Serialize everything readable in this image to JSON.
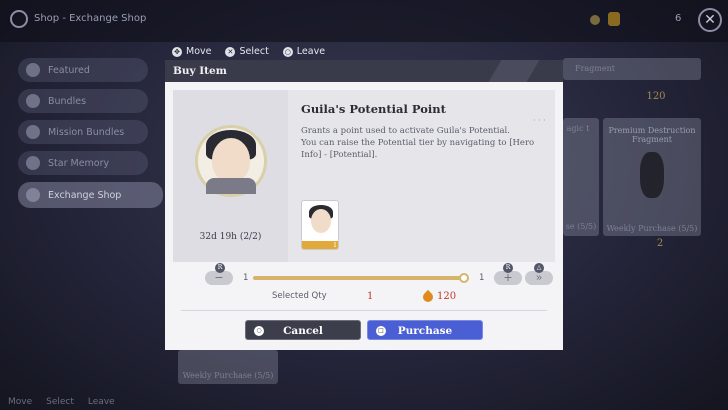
{
  "header": {
    "breadcrumb": "Shop - Exchange Shop",
    "top_count": "6",
    "close_symbol": "✕"
  },
  "hints": [
    {
      "icon": "✥",
      "label": "Move"
    },
    {
      "icon": "✕",
      "label": "Select"
    },
    {
      "icon": "○",
      "label": "Leave"
    }
  ],
  "sidebar": {
    "items": [
      {
        "label": "Featured"
      },
      {
        "label": "Bundles"
      },
      {
        "label": "Mission Bundles"
      },
      {
        "label": "Star Memory"
      },
      {
        "label": "Exchange Shop",
        "active": true
      }
    ]
  },
  "background_cards": {
    "fragment_tab": "Fragment",
    "fragment_price": "120",
    "magic_title": "agic t",
    "magic_purchase": "se (5/5)",
    "destruction_title": "Premium Destruction Fragment",
    "destruction_purchase": "Weekly Purchase (5/5)",
    "destruction_price": "2",
    "lower_purchase": "Weekly Purchase (5/5)"
  },
  "bottom_hints": [
    "Move",
    "Select",
    "Leave"
  ],
  "modal": {
    "title": "Buy Item",
    "item_name": "Guila's Potential Point",
    "item_description_1": "Grants a point used to activate Guila's Potential.",
    "item_description_2": "You can raise the Potential tier by navigating to [Hero Info] - [Potential].",
    "timer": "32d 19h (2/2)",
    "thumb_count": "1",
    "qty_min": "1",
    "qty_max": "1",
    "minus_symbol": "−",
    "plus_symbol": "+",
    "max_symbol": "»",
    "r_tag": "R",
    "tri_tag": "△",
    "selected_qty_label": "Selected Qty",
    "selected_qty_value": "1",
    "price": "120",
    "cancel_label": "Cancel",
    "purchase_label": "Purchase",
    "slider_fraction": 1.0
  },
  "colors": {
    "accent_blue": "#4a5fd4",
    "price_red": "#c0392b",
    "gold": "#d6b46a"
  }
}
